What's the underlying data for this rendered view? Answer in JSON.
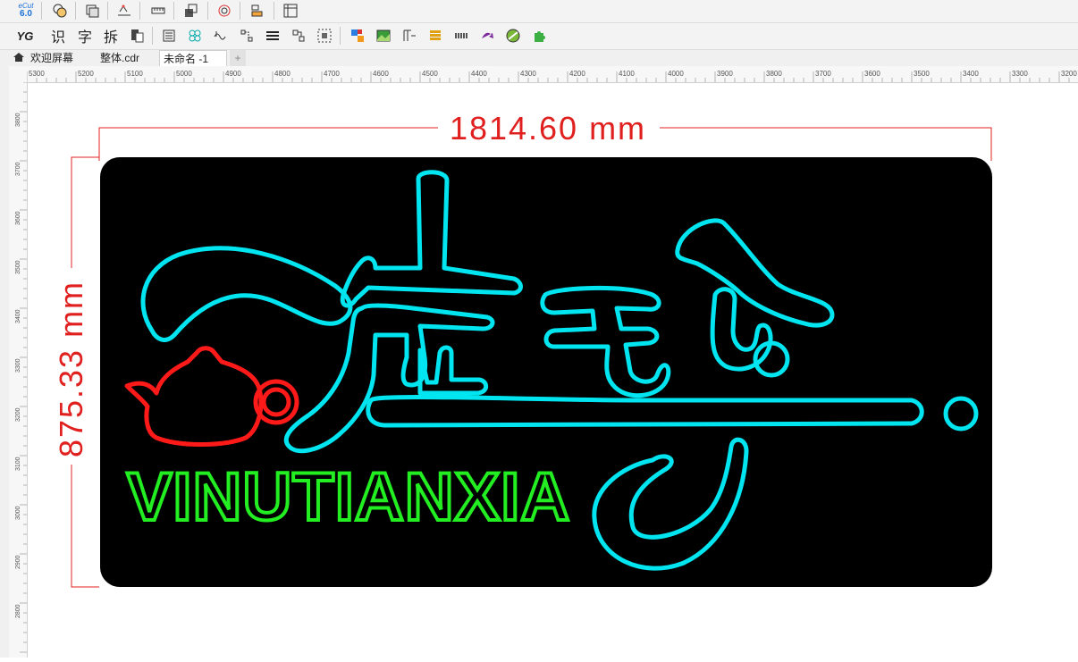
{
  "app": {
    "logo_line1": "eCut",
    "logo_line2": "6.0"
  },
  "toolbar2": {
    "char_recognize": "识",
    "char_text": "字",
    "char_split": "拆"
  },
  "tabs": [
    {
      "label": "欢迎屏幕"
    },
    {
      "label": "整体.cdr"
    },
    {
      "label": "未命名 -1"
    }
  ],
  "add_tab": "+",
  "ruler": {
    "h_ticks": [
      "5300",
      "5200",
      "5100",
      "5000",
      "4900",
      "4800",
      "4700",
      "4600",
      "4500",
      "4400",
      "4300",
      "4200",
      "4100",
      "4000",
      "3900",
      "3800",
      "3700",
      "3600",
      "3500",
      "3400",
      "3300",
      "3200"
    ],
    "v_ticks": [
      "3800",
      "3700",
      "3600",
      "3500",
      "3400",
      "3300",
      "3200",
      "3100",
      "3000",
      "2900",
      "2800"
    ]
  },
  "dimensions": {
    "width": "1814.60 mm",
    "height": "875.33 mm"
  },
  "sign": {
    "text": "VINUTIANXIA",
    "colors": {
      "background": "#000000",
      "cyan": "#00e5f0",
      "red": "#ff1a1a",
      "green": "#22ee22",
      "dimension": "#e0201f"
    }
  }
}
